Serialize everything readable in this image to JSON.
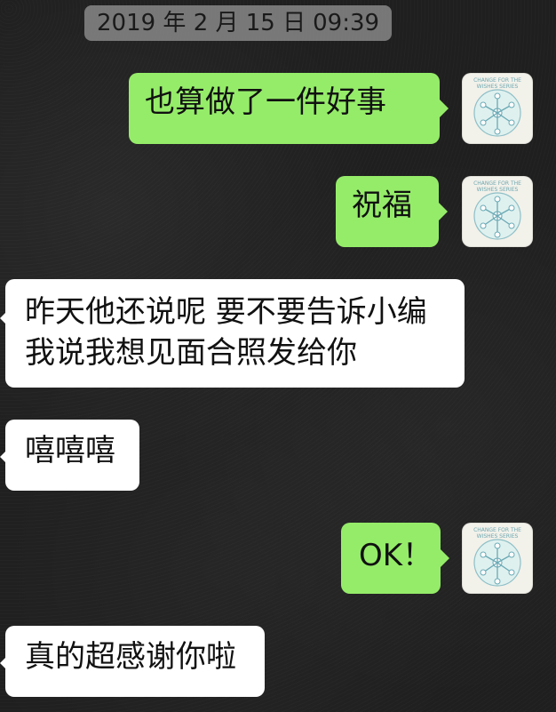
{
  "timestamp": {
    "date": "2019 年 2 月 15 日",
    "time": "09:39"
  },
  "messages": [
    {
      "side": "sent",
      "text": "也算做了一件好事"
    },
    {
      "side": "sent",
      "text": "祝福"
    },
    {
      "side": "received",
      "lines": [
        "昨天他还说呢 要不要告诉小编",
        "我说我想见面合照发给你"
      ]
    },
    {
      "side": "received",
      "text": "嘻嘻嘻"
    },
    {
      "side": "sent",
      "text": "OK！"
    },
    {
      "side": "received",
      "text": "真的超感谢你啦"
    }
  ],
  "avatar": {
    "icon": "dandelion-illustration-avatar",
    "tiny_text_line1": "CHANGE FOR THE",
    "tiny_text_line2": "WISHES SERIES"
  },
  "colors": {
    "sent_bubble": "#95ec69",
    "received_bubble": "#ffffff",
    "timestamp_bg": "rgba(150,150,150,0.75)"
  }
}
